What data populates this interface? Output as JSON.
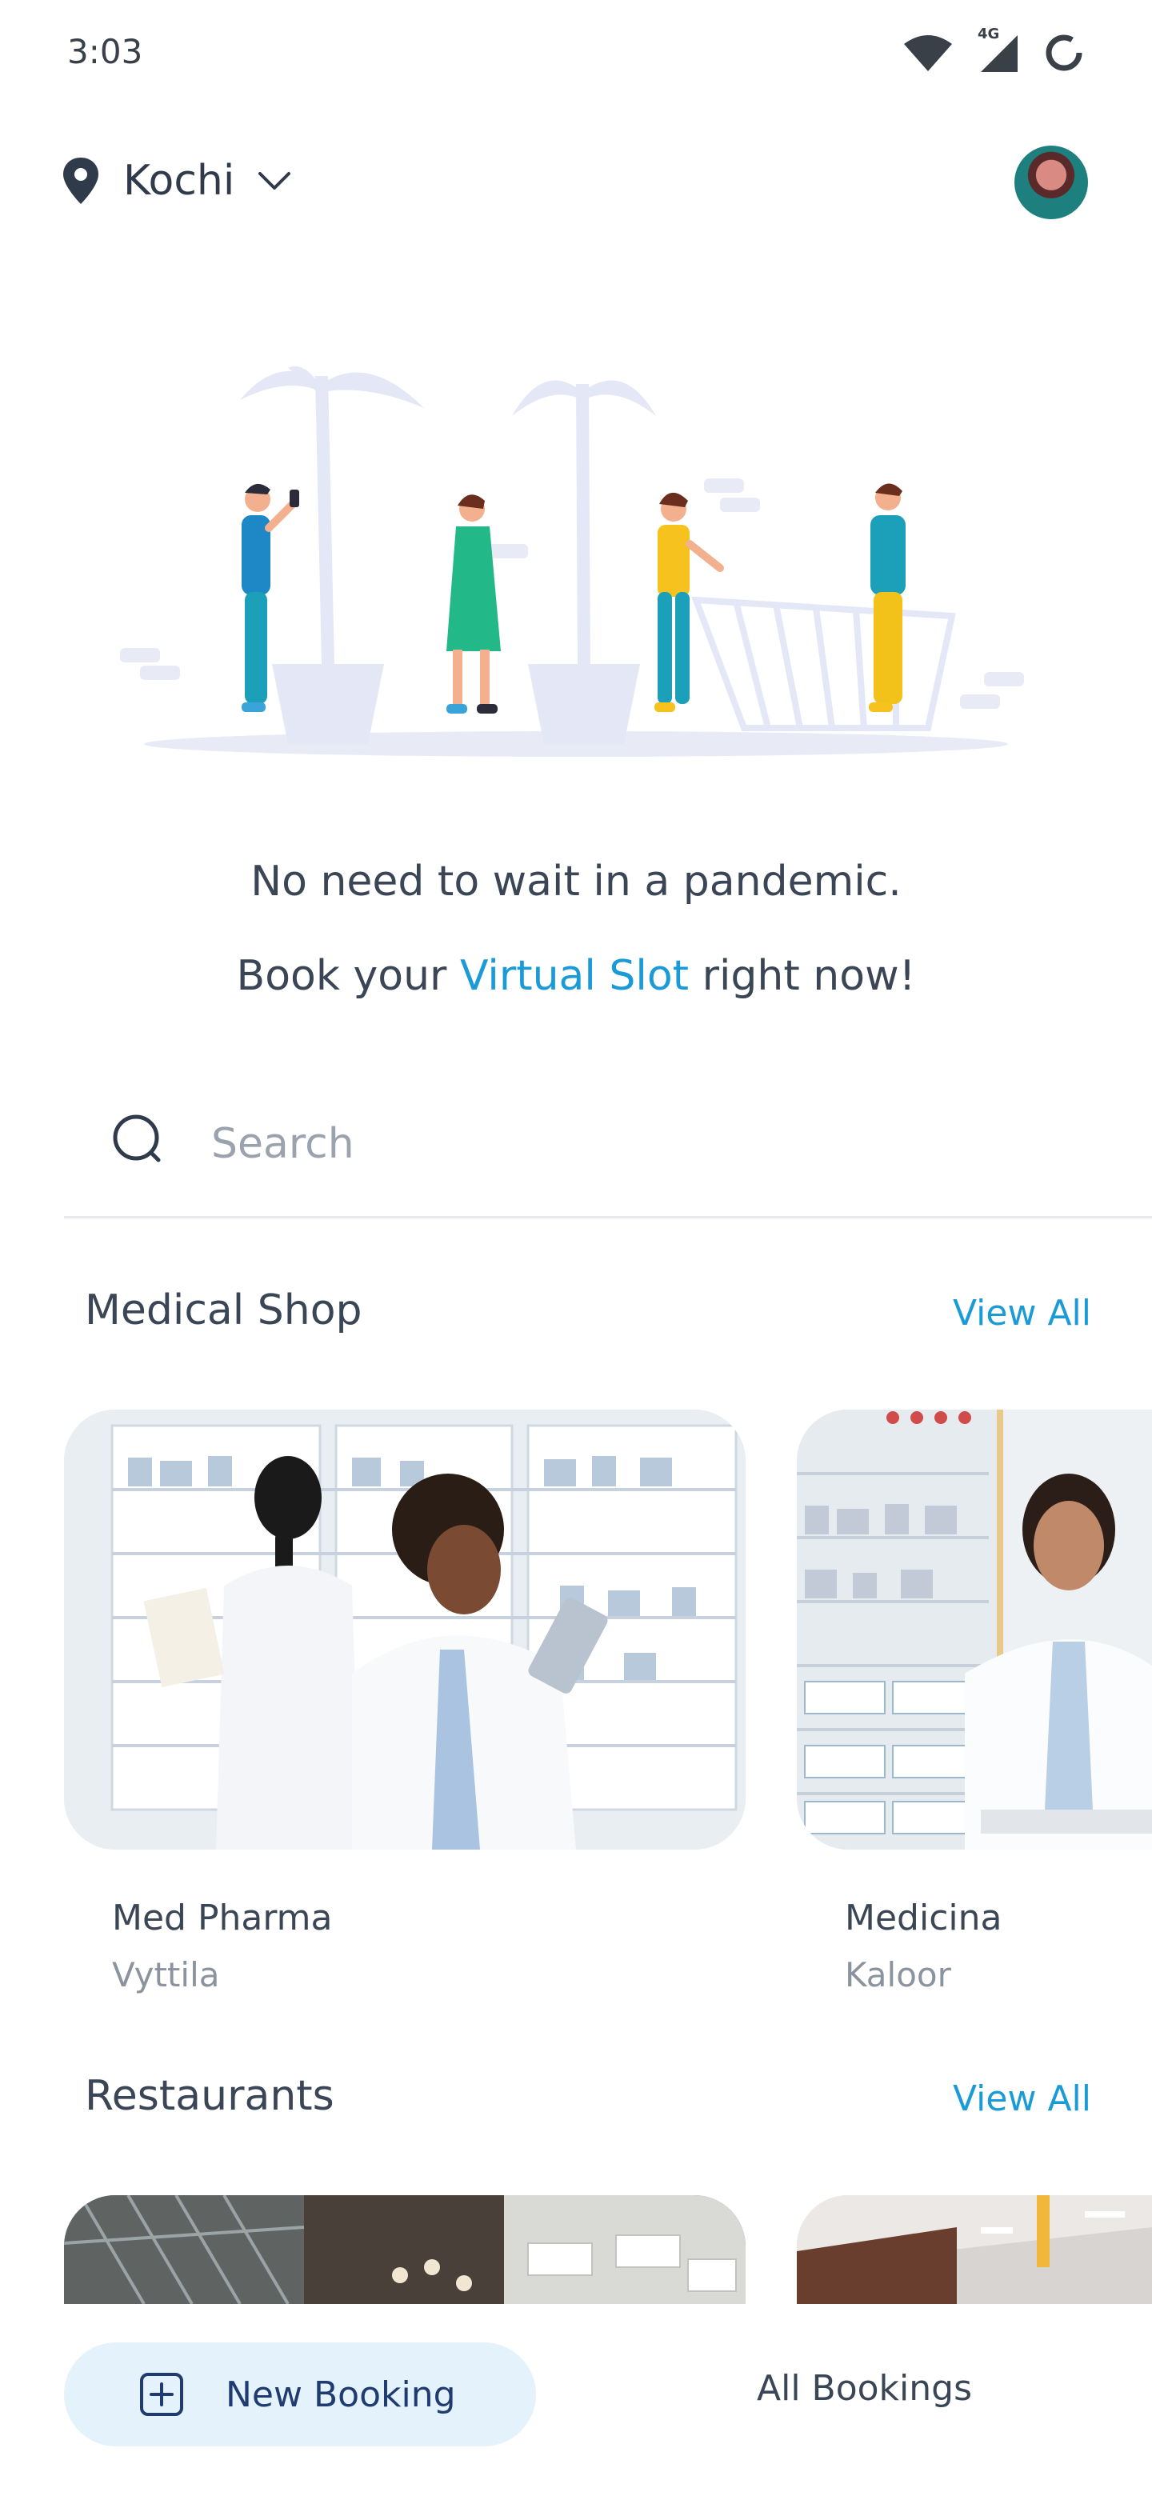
{
  "status_bar": {
    "time": "3:03",
    "network": "4G"
  },
  "header": {
    "location": "Kochi"
  },
  "hero": {
    "line1": "No need to wait in a pandemic.",
    "line2_prefix": "Book your",
    "line2_highlight": "Virtual Slot",
    "line2_suffix": "right now!"
  },
  "search": {
    "placeholder": "Search"
  },
  "sections": {
    "medical": {
      "title": "Medical Shop",
      "view_all": "View All",
      "items": [
        {
          "name": "Med Pharma",
          "location": "Vyttila"
        },
        {
          "name": "Medicina",
          "location": "Kaloor"
        }
      ]
    },
    "restaurants": {
      "title": "Restaurants",
      "view_all": "View All"
    }
  },
  "bottom_nav": {
    "new_booking": "New Booking",
    "all_bookings": "All Bookings"
  },
  "colors": {
    "accent": "#1a9bd7",
    "text": "#2f3b4a",
    "muted": "#8a939e",
    "button_bg": "#e3f2fb"
  }
}
